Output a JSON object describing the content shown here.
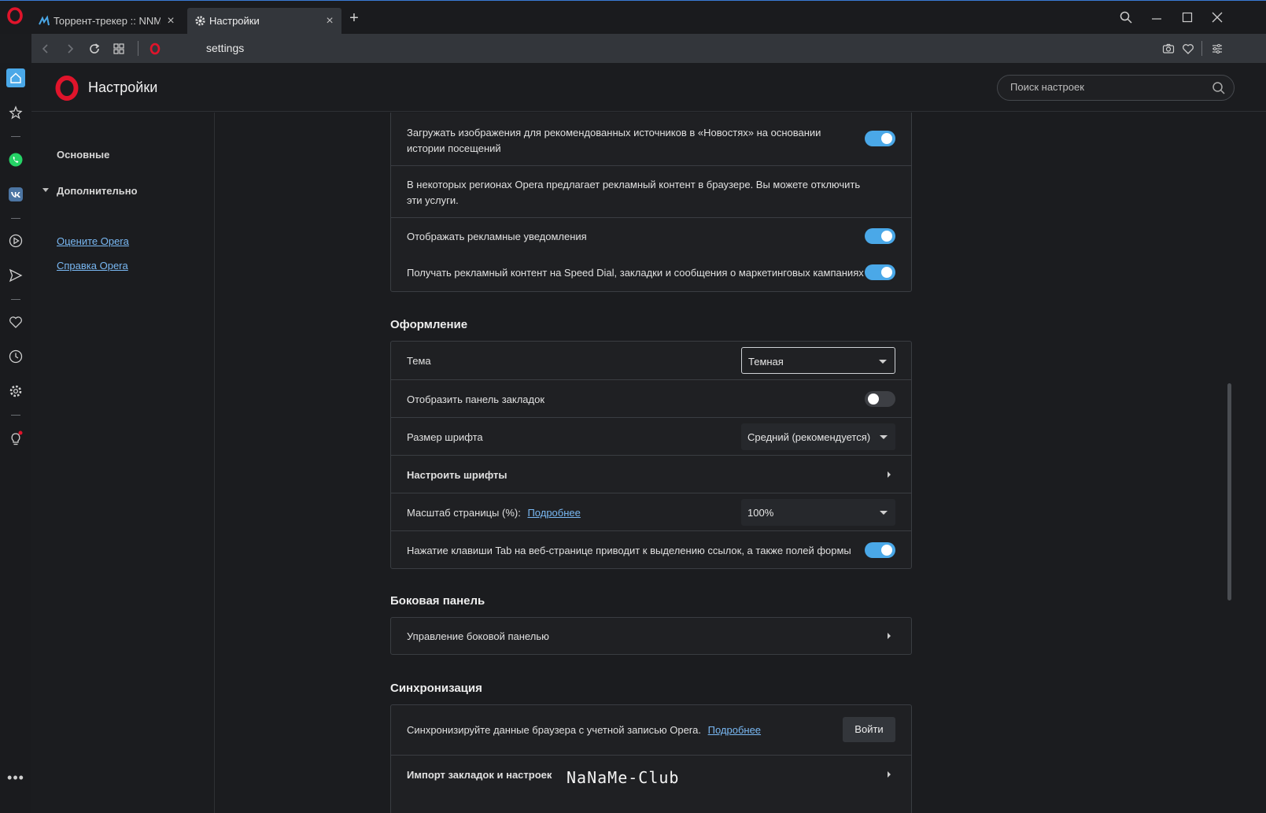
{
  "tabs": [
    {
      "label": "Торрент-трекер :: NNM-Cl",
      "icon": "nnm-favicon",
      "active": false
    },
    {
      "label": "Настройки",
      "icon": "gear-icon",
      "active": true
    }
  ],
  "address": {
    "url": "settings"
  },
  "header": {
    "title": "Настройки",
    "search_placeholder": "Поиск настроек"
  },
  "leftnav": {
    "basic": "Основные",
    "advanced": "Дополнительно",
    "rate_link": "Оцените Opera",
    "help_link": "Справка Opera"
  },
  "ads_card": {
    "row1": "Загружать изображения для рекомендованных источников в «Новостях» на основании истории посещений",
    "row2": "В некоторых регионах Opera предлагает рекламный контент в браузере. Вы можете отключить эти услуги.",
    "row3": "Отображать рекламные уведомления",
    "row4": "Получать рекламный контент на Speed Dial, закладки и сообщения о маркетинговых кампаниях",
    "row1_on": true,
    "row3_on": true,
    "row4_on": true
  },
  "appearance": {
    "title": "Оформление",
    "theme_label": "Тема",
    "theme_value": "Темная",
    "bookmarks_bar_label": "Отобразить панель закладок",
    "bookmarks_bar_on": false,
    "font_size_label": "Размер шрифта",
    "font_size_value": "Средний (рекомендуется)",
    "customize_fonts_label": "Настроить шрифты",
    "zoom_label": "Масштаб страницы (%):",
    "zoom_link": "Подробнее",
    "zoom_value": "100%",
    "tab_highlight_label": "Нажатие клавиши Tab на веб-странице приводит к выделению ссылок, а также полей формы",
    "tab_highlight_on": true
  },
  "sidebar_section": {
    "title": "Боковая панель",
    "manage_label": "Управление боковой панелью"
  },
  "sync": {
    "title": "Синхронизация",
    "sync_text": "Синхронизируйте данные браузера с учетной записью Opera.",
    "sync_link": "Подробнее",
    "login_button": "Войти",
    "import_label": "Импорт закладок и настроек"
  },
  "watermark": "NaNaMe-Club",
  "colors": {
    "accent": "#4aa8e8",
    "link": "#79b8f3",
    "opera_red": "#e0142b"
  }
}
